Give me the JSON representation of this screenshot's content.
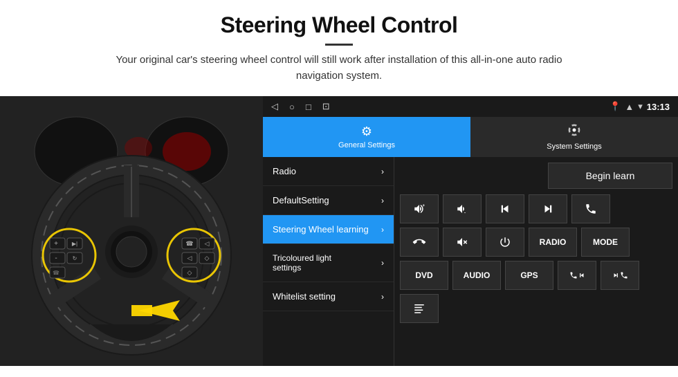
{
  "header": {
    "title": "Steering Wheel Control",
    "subtitle": "Your original car's steering wheel control will still work after installation of this all-in-one auto radio navigation system."
  },
  "status_bar": {
    "time": "13:13",
    "nav_icons": [
      "◁",
      "○",
      "□",
      "⊡"
    ]
  },
  "tabs": [
    {
      "id": "general",
      "label": "General Settings",
      "active": true
    },
    {
      "id": "system",
      "label": "System Settings",
      "active": false
    }
  ],
  "menu_items": [
    {
      "label": "Radio",
      "active": false
    },
    {
      "label": "DefaultSetting",
      "active": false
    },
    {
      "label": "Steering Wheel learning",
      "active": true
    },
    {
      "label": "Tricoloured light settings",
      "active": false
    },
    {
      "label": "Whitelist setting",
      "active": false
    }
  ],
  "begin_learn_label": "Begin learn",
  "control_buttons": {
    "row1": [
      "vol+",
      "vol-",
      "prev",
      "next",
      "phone"
    ],
    "row2": [
      "phone-end",
      "mute",
      "power",
      "RADIO",
      "MODE"
    ],
    "row3": [
      "DVD",
      "AUDIO",
      "GPS",
      "phone-prev",
      "phone-next"
    ]
  }
}
